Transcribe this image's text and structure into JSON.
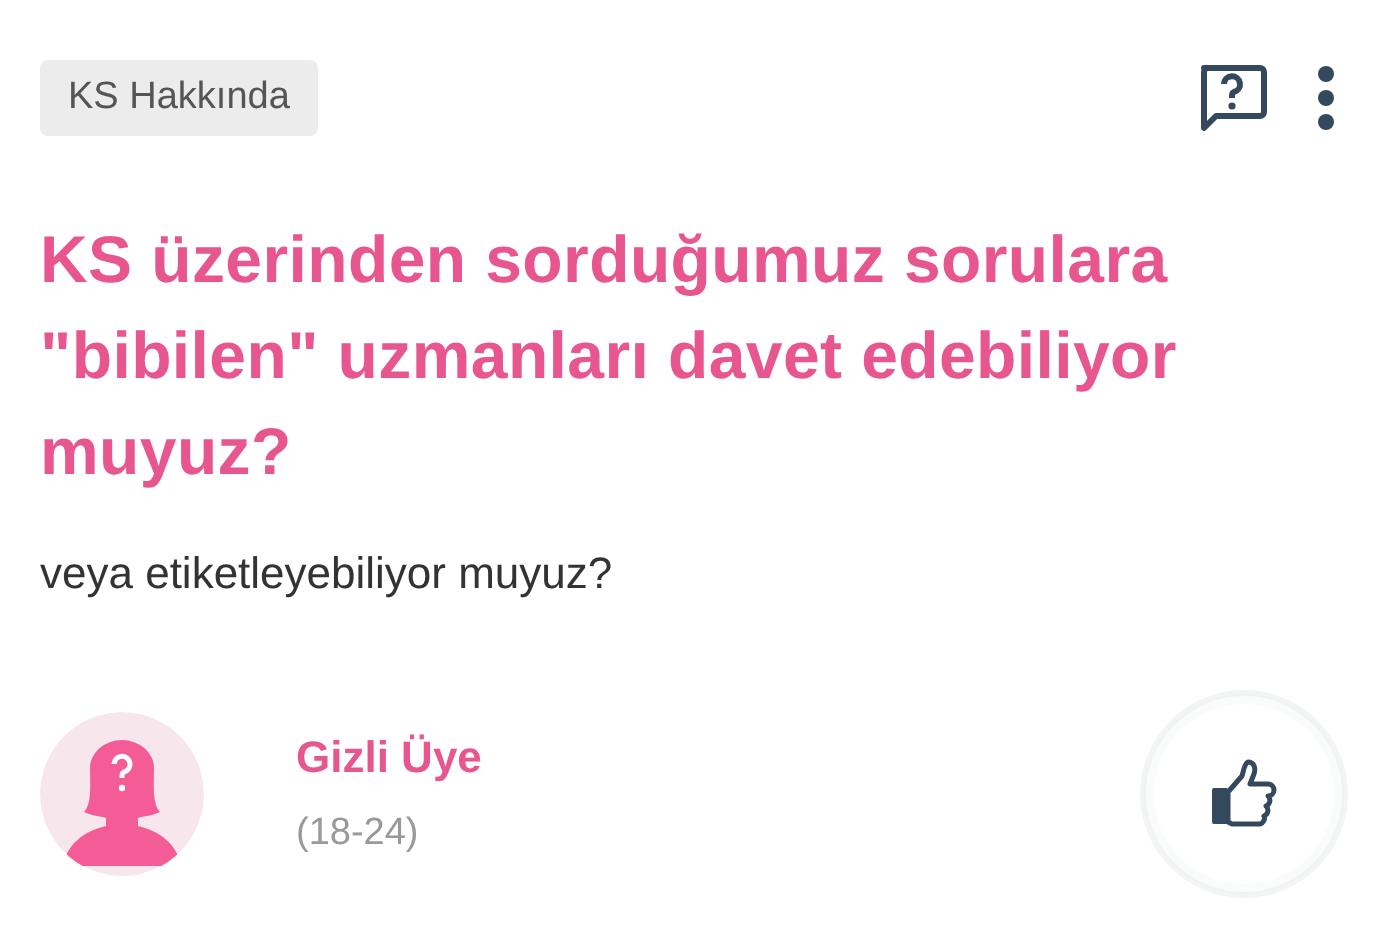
{
  "category_tag": "KS Hakkında",
  "question": {
    "title": "KS üzerinden sorduğumuz sorulara \"bibilen\" uzmanları davet edebiliyor muyuz?",
    "description": "veya etiketleyebiliyor muyuz?"
  },
  "author": {
    "name": "Gizli Üye",
    "age_range": "(18-24)"
  }
}
